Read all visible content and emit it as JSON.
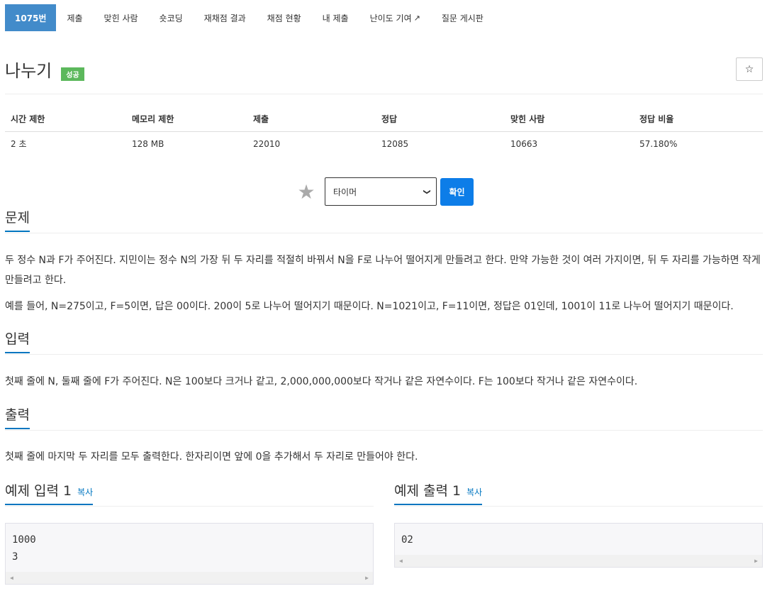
{
  "nav": {
    "items": [
      "1075번",
      "제출",
      "맞힌 사람",
      "숏코딩",
      "재채점 결과",
      "채점 현황",
      "내 제출",
      "난이도 기여",
      "질문 게시판"
    ]
  },
  "problem": {
    "title": "나누기",
    "badge": "성공",
    "star_icon": "☆"
  },
  "info": {
    "headers": [
      "시간 제한",
      "메모리 제한",
      "제출",
      "정답",
      "맞힌 사람",
      "정답 비율"
    ],
    "values": [
      "2 초",
      "128 MB",
      "22010",
      "12085",
      "10663",
      "57.180%"
    ]
  },
  "tier": {
    "selected": "타이머",
    "confirm_label": "확인"
  },
  "sections": {
    "description": {
      "title": "문제",
      "paragraphs": [
        "두 정수 N과 F가 주어진다. 지민이는 정수 N의 가장 뒤 두 자리를 적절히 바꿔서 N을 F로 나누어 떨어지게 만들려고 한다. 만약 가능한 것이 여러 가지이면, 뒤 두 자리를 가능하면 작게 만들려고 한다.",
        "예를 들어, N=275이고, F=5이면, 답은 00이다. 200이 5로 나누어 떨어지기 때문이다. N=1021이고, F=11이면, 정답은 01인데, 1001이 11로 나누어 떨어지기 때문이다."
      ]
    },
    "input": {
      "title": "입력",
      "text": "첫째 줄에 N, 둘째 줄에 F가 주어진다. N은 100보다 크거나 같고, 2,000,000,000보다 작거나 같은 자연수이다. F는 100보다 작거나 같은 자연수이다."
    },
    "output": {
      "title": "출력",
      "text": "첫째 줄에 마지막 두 자리를 모두 출력한다. 한자리이면 앞에 0을 추가해서 두 자리로 만들어야 한다."
    }
  },
  "samples": {
    "copy_label": "복사",
    "input": {
      "title": "예제 입력 1",
      "text": "1000\n3"
    },
    "output": {
      "title": "예제 출력 1",
      "text": "02"
    }
  },
  "colors": {
    "active_tab": "#428bca",
    "success_badge": "#5cb85c",
    "confirm_button": "#0d7de8",
    "section_underline": "#0076c0"
  }
}
